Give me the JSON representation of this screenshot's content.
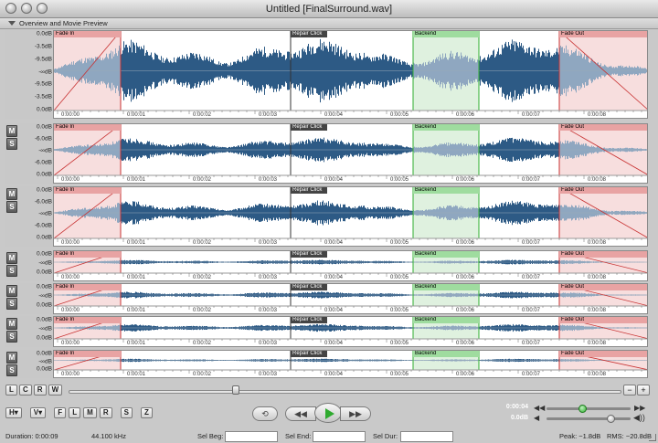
{
  "window": {
    "title": "Untitled [FinalSurround.wav]"
  },
  "overview": {
    "label": "Overview and Movie Preview"
  },
  "regions": [
    {
      "label": "Fade In",
      "color": "#c83232",
      "fill": "#f7dede",
      "kind": "fade-in"
    },
    {
      "label": "Repair Click",
      "color": "#333333",
      "kind": "marker"
    },
    {
      "label": "Backend",
      "color": "#2fae2f",
      "fill": "#dff1df",
      "kind": "range"
    },
    {
      "label": "Fade Out",
      "color": "#c83232",
      "fill": "#f7dede",
      "kind": "fade-out"
    }
  ],
  "time_labels": [
    "0:00:00",
    "0:00:01",
    "0:00:02",
    "0:00:03",
    "0:00:04",
    "0:00:05",
    "0:00:06",
    "0:00:07",
    "0:00:08"
  ],
  "overview_db": [
    "0.0dB",
    "-3.5dB",
    "-9.5dB",
    "-∞dB",
    "-9.5dB",
    "-3.5dB",
    "0.0dB"
  ],
  "channels": [
    {
      "db": [
        "0.0dB",
        "-6.0dB",
        "-∞dB",
        "-6.0dB",
        "0.0dB"
      ],
      "amp": 0.55
    },
    {
      "db": [
        "0.0dB",
        "-6.0dB",
        "-∞dB",
        "-6.0dB",
        "0.0dB"
      ],
      "amp": 0.55
    },
    {
      "db": [
        "0.0dB",
        "-∞dB",
        "0.0dB"
      ],
      "amp": 0.25
    },
    {
      "db": [
        "0.0dB",
        "-∞dB",
        "0.0dB"
      ],
      "amp": 0.35
    },
    {
      "db": [
        "0.0dB",
        "-∞dB",
        "0.0dB"
      ],
      "amp": 0.4
    },
    {
      "db": [
        "0.0dB",
        "-∞dB",
        "0.0dB"
      ],
      "amp": 0.2
    }
  ],
  "ms": {
    "m": "M",
    "s": "S"
  },
  "lcrw": [
    "L",
    "C",
    "R",
    "W"
  ],
  "zoom": {
    "minus": "−",
    "plus": "+"
  },
  "view_buttons": {
    "h": "H▾",
    "v": "V▾",
    "f": "F",
    "l": "L",
    "m": "M",
    "r": "R",
    "s": "S",
    "z": "Z"
  },
  "transport": {
    "loop": "⟲",
    "rewind": "◀◀",
    "forward": "▶▶",
    "play_state": "stopped"
  },
  "playhead": {
    "time": "0:00:04",
    "gain": "0.0dB",
    "time_level": 0.4,
    "gain_level": 0.75
  },
  "status": {
    "duration": "Duration: 0:00:09",
    "rate": "44.100 kHz",
    "sel_beg_label": "Sel Beg:",
    "sel_end_label": "Sel End:",
    "sel_dur_label": "Sel Dur:",
    "sel_beg": "",
    "sel_end": "",
    "sel_dur": "",
    "peak": "Peak: −1.8dB",
    "rms": "RMS: −20.8dB"
  },
  "colors": {
    "wave": "#2d5a85",
    "wave_light": "#8fa7c0",
    "accent_green": "#2fae2f",
    "accent_red": "#c83232"
  }
}
